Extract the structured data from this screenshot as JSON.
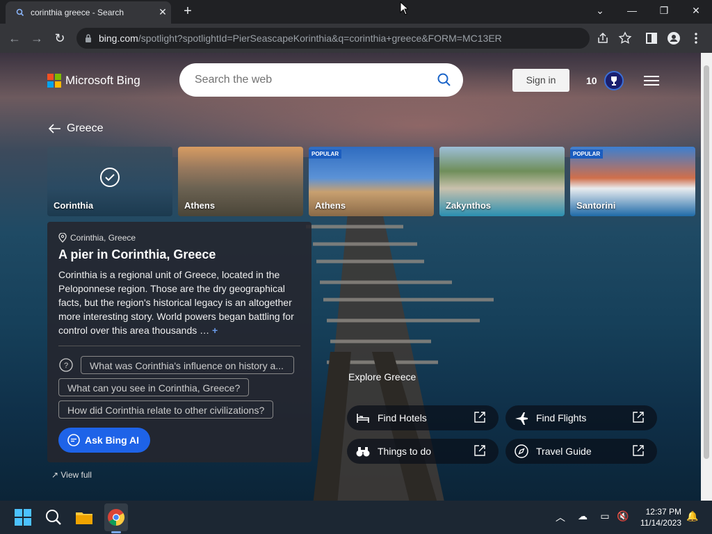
{
  "browser": {
    "tab_title": "corinthia greece - Search",
    "url_host": "bing.com",
    "url_path": "/spotlight?spotlightId=PierSeascapeKorinthia&q=corinthia+greece&FORM=MC13ER"
  },
  "header": {
    "brand": "Microsoft Bing",
    "search_placeholder": "Search the web",
    "sign_in": "Sign in",
    "rewards_points": "10"
  },
  "back_label": "Greece",
  "tiles": [
    {
      "label": "Corinthia",
      "popular": "",
      "selected": true
    },
    {
      "label": "Athens",
      "popular": ""
    },
    {
      "label": "Athens",
      "popular": "POPULAR"
    },
    {
      "label": "Zakynthos",
      "popular": ""
    },
    {
      "label": "Santorini",
      "popular": "POPULAR"
    }
  ],
  "info": {
    "location": "Corinthia, Greece",
    "title": "A pier in Corinthia, Greece",
    "description": "Corinthia is a regional unit of Greece, located in the Peloponnese region. Those are the dry geographical facts, but the region's historical legacy is an altogether more interesting story. World powers began battling for control over this area thousands …",
    "more": "+",
    "questions": [
      "What was Corinthia's influence on history a...",
      "What can you see in Corinthia, Greece?",
      "How did Corinthia relate to other civilizations?"
    ],
    "ask_label": "Ask Bing AI",
    "view_full": "View full"
  },
  "explore": {
    "title": "Explore Greece",
    "buttons": [
      {
        "label": "Find Hotels",
        "icon": "bed-icon"
      },
      {
        "label": "Find Flights",
        "icon": "airplane-icon"
      },
      {
        "label": "Things to do",
        "icon": "binoculars-icon"
      },
      {
        "label": "Travel Guide",
        "icon": "compass-icon"
      }
    ]
  },
  "taskbar": {
    "time": "12:37 PM",
    "date": "11/14/2023"
  },
  "colors": {
    "bing_accent": "#1e63e8",
    "popular_badge": "#1b5dbf"
  }
}
